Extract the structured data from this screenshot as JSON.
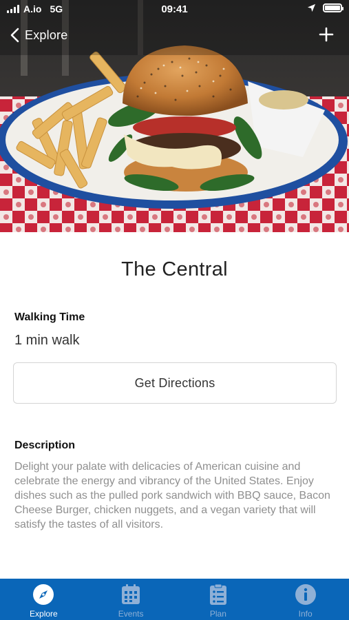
{
  "status_bar": {
    "carrier": "A.io",
    "network": "5G",
    "time": "09:41",
    "location_icon": "location-arrow-icon",
    "battery_icon": "battery-full-icon"
  },
  "nav": {
    "back_label": "Explore",
    "back_icon": "chevron-left-icon",
    "add_icon": "plus-icon"
  },
  "hero": {
    "image_subject": "burger-with-fries-photo"
  },
  "place": {
    "title": "The Central"
  },
  "walking": {
    "heading": "Walking Time",
    "value": "1 min walk"
  },
  "directions_button": {
    "label": "Get Directions"
  },
  "description": {
    "heading": "Description",
    "text": "Delight your palate with delicacies of American cuisine and celebrate the energy and vibrancy of the United States. Enjoy dishes such as the pulled pork sandwich with BBQ sauce, Bacon Cheese Burger, chicken nuggets, and a vegan variety that will satisfy the tastes of all visitors."
  },
  "tabbar": {
    "background": "#0a66b8",
    "tabs": [
      {
        "label": "Explore",
        "icon": "compass-icon",
        "active": true
      },
      {
        "label": "Events",
        "icon": "calendar-icon",
        "active": false
      },
      {
        "label": "Plan",
        "icon": "checklist-icon",
        "active": false
      },
      {
        "label": "Info",
        "icon": "info-icon",
        "active": false
      }
    ]
  }
}
